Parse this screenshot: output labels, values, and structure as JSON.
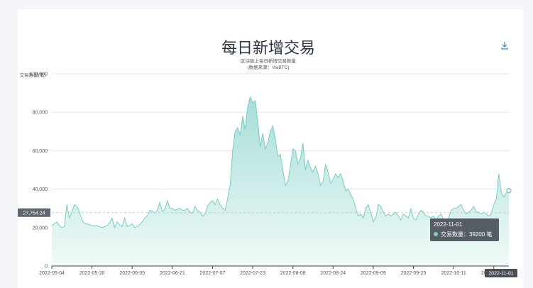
{
  "title": "每日新增交易",
  "subtitle_line1": "区块链上每日新增交易数量",
  "subtitle_line2": "(数据来源：ViaBTC)",
  "download_icon": "download-icon",
  "chart_data": {
    "type": "area",
    "ylabel": "交易数量(笔)",
    "ylim": [
      0,
      100000
    ],
    "yticks": [
      "0",
      "20,000",
      "40,000",
      "60,000",
      "80,000",
      "100,000"
    ],
    "xticks": [
      "2022-05-04",
      "2022-05-20",
      "2022-06-05",
      "2022-06-21",
      "2022-07-07",
      "2022-07-23",
      "2022-08-08",
      "2022-08-24",
      "2022-09-09",
      "2022-09-25",
      "2022-10-11",
      "2022-10-27"
    ],
    "average_line": 27754.24,
    "average_label": "27,754.24",
    "line_color": "#78ccc8",
    "fill_color_top": "#a7ddd9",
    "fill_color_bottom": "#effaf7",
    "series": [
      {
        "name": "交易数量",
        "x_start": "2022-05-04",
        "x_end": "2022-11-01",
        "values": [
          21000,
          22000,
          23000,
          21000,
          20000,
          20500,
          32000,
          25000,
          28000,
          32000,
          31000,
          28000,
          24000,
          22000,
          22000,
          21500,
          21000,
          21000,
          21000,
          20500,
          20000,
          20500,
          21000,
          22500,
          25000,
          20000,
          23000,
          21500,
          20500,
          25000,
          20500,
          21000,
          22000,
          20000,
          20500,
          21500,
          23000,
          25000,
          26000,
          29000,
          28500,
          27500,
          29000,
          33000,
          28500,
          29500,
          34000,
          30000,
          30000,
          29000,
          29500,
          30000,
          29000,
          29000,
          30000,
          28000,
          27500,
          31000,
          29000,
          28000,
          26000,
          27000,
          31000,
          33000,
          34000,
          32000,
          35000,
          32000,
          30000,
          29000,
          35000,
          42000,
          60000,
          70000,
          72000,
          68000,
          78000,
          71000,
          83000,
          88000,
          85000,
          86000,
          75000,
          62000,
          69000,
          61000,
          64000,
          70000,
          73000,
          66000,
          57000,
          58000,
          50000,
          42000,
          44000,
          52000,
          61000,
          60000,
          53000,
          56000,
          64000,
          50000,
          55000,
          51000,
          49000,
          52000,
          48000,
          42000,
          44000,
          53000,
          49000,
          43000,
          45000,
          48000,
          46000,
          48000,
          44000,
          39000,
          40000,
          37000,
          35000,
          30000,
          26000,
          27000,
          25000,
          30000,
          32000,
          28000,
          23000,
          25000,
          32000,
          31000,
          28000,
          26000,
          27000,
          26000,
          27000,
          28000,
          26000,
          24000,
          27000,
          26000,
          25000,
          30000,
          25000,
          24000,
          27000,
          29000,
          28000,
          26000,
          26000,
          25000,
          26000,
          24000,
          26000,
          27000,
          24000,
          23000,
          25000,
          29000,
          30000,
          30000,
          31000,
          32000,
          29000,
          27000,
          28000,
          29000,
          31000,
          28000,
          28000,
          27000,
          28000,
          27000,
          26000,
          27000,
          32000,
          35000,
          48000,
          38000,
          36000,
          38000,
          39200
        ]
      }
    ],
    "tooltip": {
      "date": "2022-11-01",
      "label": "交易数量：",
      "value": "39200",
      "unit": "笔"
    },
    "pointer_label": "2022-11-01"
  }
}
